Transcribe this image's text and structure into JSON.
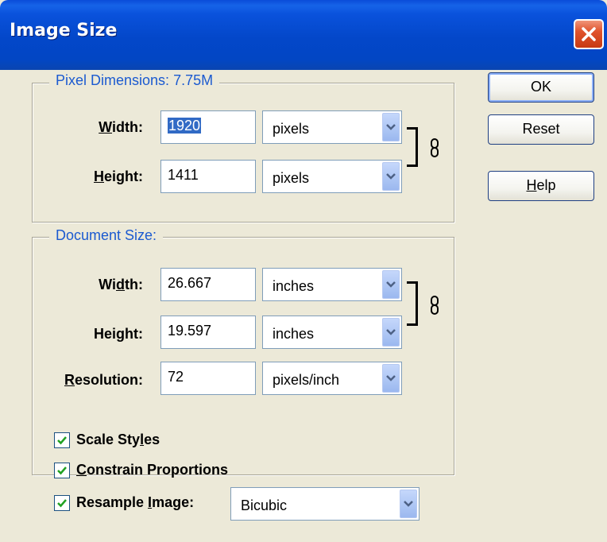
{
  "window": {
    "title": "Image Size"
  },
  "pixel_dimensions": {
    "legend": "Pixel Dimensions:",
    "size": "7.75M",
    "width": {
      "label_pre": "",
      "label_u": "W",
      "label_post": "idth:",
      "value": "1920",
      "unit": "pixels"
    },
    "height": {
      "label_pre": "",
      "label_u": "H",
      "label_post": "eight:",
      "value": "1411",
      "unit": "pixels"
    }
  },
  "document_size": {
    "legend": "Document Size:",
    "width": {
      "label_pre": "Wi",
      "label_u": "d",
      "label_post": "th:",
      "value": "26.667",
      "unit": "inches"
    },
    "height": {
      "label_pre": "Hei",
      "label_u": "g",
      "label_post": "ht:",
      "value": "19.597",
      "unit": "inches"
    },
    "resolution": {
      "label_pre": "",
      "label_u": "R",
      "label_post": "esolution:",
      "value": "72",
      "unit": "pixels/inch"
    }
  },
  "buttons": {
    "ok": "OK",
    "reset": "Reset",
    "help_u": "H",
    "help_rest": "elp"
  },
  "options": {
    "scale_styles": {
      "pre": "Scale Sty",
      "u": "l",
      "post": "es",
      "checked": true
    },
    "constrain": {
      "pre": "",
      "u": "C",
      "post": "onstrain Proportions",
      "checked": true
    },
    "resample": {
      "pre": "Resample ",
      "u": "I",
      "post": "mage:",
      "checked": true,
      "method": "Bicubic"
    }
  },
  "colors": {
    "titlebar": "#0347c9",
    "legend_text": "#1b5ad0",
    "dialog_bg": "#ece9d8",
    "close_button": "#e0532c"
  }
}
